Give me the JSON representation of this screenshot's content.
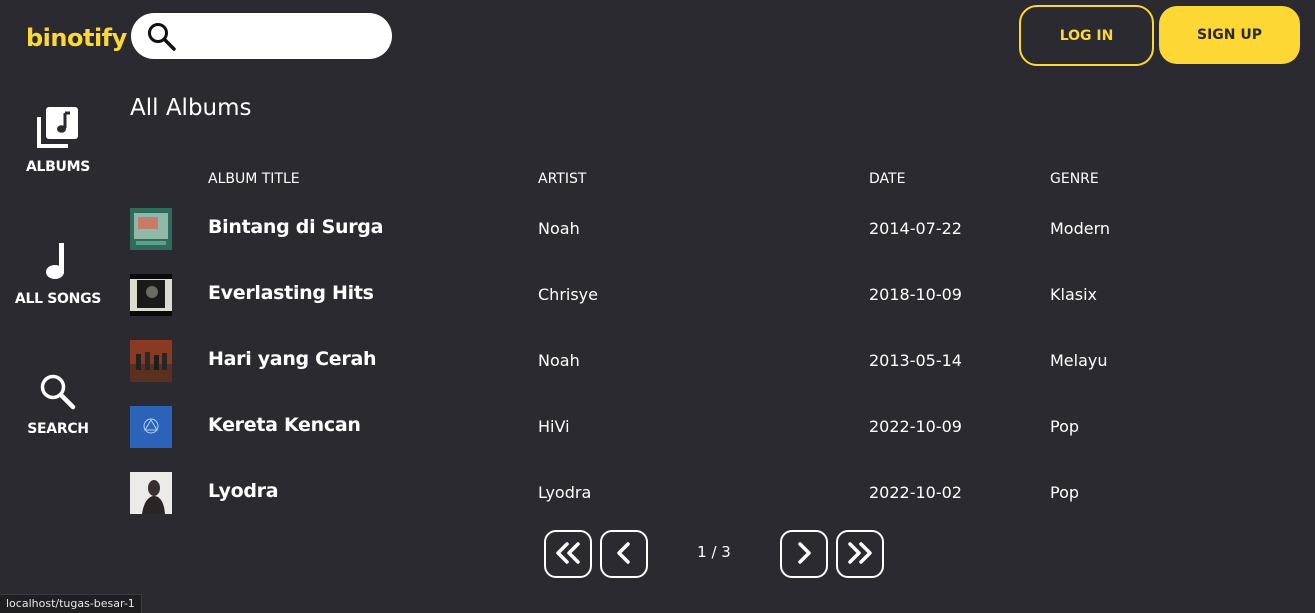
{
  "app": {
    "name": "binotify"
  },
  "header": {
    "search_placeholder": "",
    "login_label": "LOG IN",
    "signup_label": "SIGN UP"
  },
  "sidebar": {
    "items": [
      {
        "label": "ALBUMS",
        "icon": "album-library-icon"
      },
      {
        "label": "ALL SONGS",
        "icon": "music-note-icon"
      },
      {
        "label": "SEARCH",
        "icon": "search-icon"
      }
    ]
  },
  "main": {
    "title": "All Albums",
    "columns": [
      "ALBUM TITLE",
      "ARTIST",
      "DATE",
      "GENRE"
    ],
    "albums": [
      {
        "title": "Bintang di Surga",
        "artist": "Noah",
        "date": "2014-07-22",
        "genre": "Modern"
      },
      {
        "title": "Everlasting Hits",
        "artist": "Chrisye",
        "date": "2018-10-09",
        "genre": "Klasix"
      },
      {
        "title": "Hari yang Cerah",
        "artist": "Noah",
        "date": "2013-05-14",
        "genre": "Melayu"
      },
      {
        "title": "Kereta Kencan",
        "artist": "HiVi",
        "date": "2022-10-09",
        "genre": "Pop"
      },
      {
        "title": "Lyodra",
        "artist": "Lyodra",
        "date": "2022-10-02",
        "genre": "Pop"
      }
    ]
  },
  "pagination": {
    "info": "1 / 3"
  },
  "status_bar": {
    "url": "localhost/tugas-besar-1"
  },
  "colors": {
    "background": "#2a2a30",
    "accent": "#fdd835",
    "text": "#ffffff"
  }
}
